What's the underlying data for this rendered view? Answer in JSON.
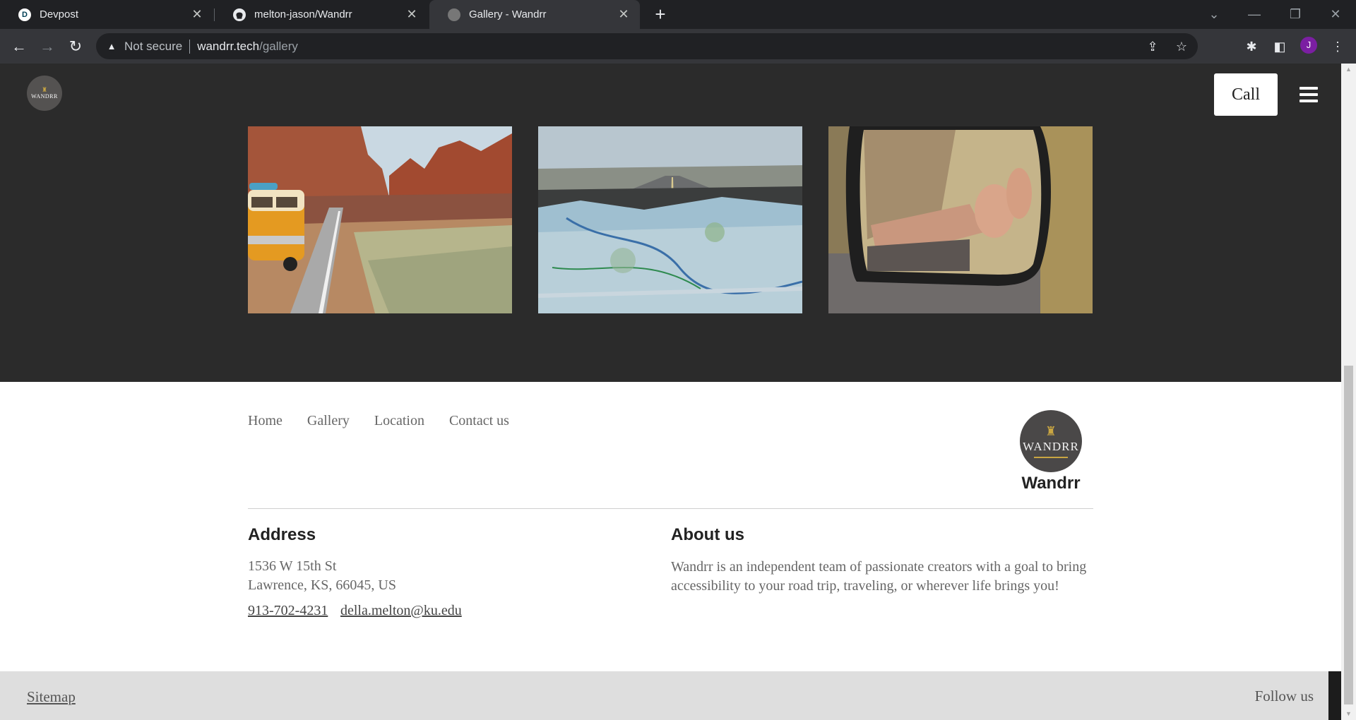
{
  "browser": {
    "tabs": [
      {
        "title": "Devpost",
        "favicon": "devpost-icon",
        "favicon_text": "D"
      },
      {
        "title": "melton-jason/Wandrr",
        "favicon": "github-icon"
      },
      {
        "title": "Gallery - Wandrr",
        "favicon": "wandrr-icon",
        "active": true
      }
    ],
    "address": {
      "security_label": "Not secure",
      "host": "wandrr.tech",
      "path": "/gallery"
    },
    "profile_initial": "J"
  },
  "header": {
    "logo_text": "WANDRR",
    "call_label": "Call"
  },
  "gallery": {
    "photos": [
      {
        "subject": "van on desert road with red rock canyon"
      },
      {
        "subject": "road map on car dashboard with highway ahead"
      },
      {
        "subject": "feet out of car window reflected in side mirror"
      }
    ]
  },
  "footer": {
    "nav": [
      "Home",
      "Gallery",
      "Location",
      "Contact us"
    ],
    "logo_text": "WANDRR",
    "brand_name": "Wandrr",
    "address_title": "Address",
    "address_lines": [
      "1536 W 15th St",
      "Lawrence, KS, 66045, US"
    ],
    "phone": "913-702-4231",
    "email": "della.melton@ku.edu",
    "about_title": "About us",
    "about_text": "Wandrr is an independent team of passionate creators with a goal to bring accessibility to your road trip, traveling, or wherever life brings you!"
  },
  "bottom_bar": {
    "sitemap_label": "Sitemap",
    "follow_label": "Follow us"
  },
  "colors": {
    "page_dark": "#2b2b2b",
    "footer_bg": "#ffffff",
    "bottom_bar": "#dedede",
    "logo_gold": "#c9a642"
  }
}
